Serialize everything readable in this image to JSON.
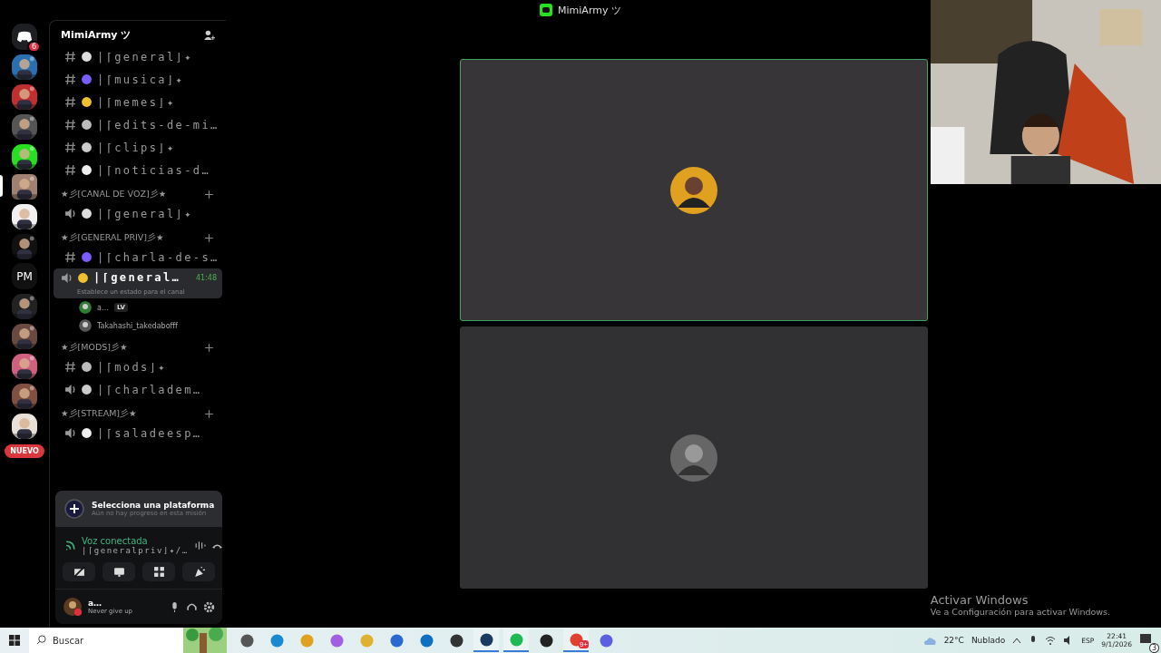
{
  "window": {
    "title": "MimiArmy ツ"
  },
  "servers": [
    {
      "kind": "home",
      "badge": "6",
      "selected": false
    },
    {
      "kind": "picture",
      "selected": false
    },
    {
      "kind": "picture",
      "selected": false
    },
    {
      "kind": "picture",
      "selected": false
    },
    {
      "kind": "picture",
      "selected": false
    },
    {
      "kind": "picture",
      "selected": true
    },
    {
      "kind": "picture",
      "selected": false
    },
    {
      "kind": "picture",
      "selected": false
    },
    {
      "kind": "text",
      "label": "PM",
      "selected": false
    },
    {
      "kind": "picture",
      "selected": false
    },
    {
      "kind": "picture",
      "selected": false
    },
    {
      "kind": "picture",
      "selected": false
    },
    {
      "kind": "picture",
      "selected": false
    },
    {
      "kind": "picture",
      "selected": false
    }
  ],
  "new_badge": "NUEVO",
  "sidebar": {
    "server_name": "MimiArmy ツ",
    "categories": [
      {
        "channels": [
          {
            "kind": "text",
            "name": "|⌈general⌋✦"
          },
          {
            "kind": "text",
            "name": "|⌈musica⌋✦"
          },
          {
            "kind": "text",
            "name": "|⌈memes⌋✦"
          },
          {
            "kind": "text",
            "name": "|⌈edits-de-mi…"
          },
          {
            "kind": "text",
            "name": "|⌈clips⌋✦"
          },
          {
            "kind": "text",
            "name": "|⌈noticias-d…"
          }
        ]
      },
      {
        "name": "★彡[CANAL DE VOZ]彡★",
        "channels": [
          {
            "kind": "voice",
            "name": "|⌈general⌋✦"
          }
        ]
      },
      {
        "name": "★彡[GENERAL PRIV]彡★",
        "channels": [
          {
            "kind": "text",
            "name": "|⌈charla-de-s…"
          },
          {
            "kind": "voice",
            "name": "|⌈general…",
            "selected": true,
            "time": "41:48",
            "status": "Establece un estado para el canal",
            "members": [
              {
                "name": "a…",
                "tag": "LV"
              },
              {
                "name": "Takahashi_takedabofff"
              }
            ]
          }
        ]
      },
      {
        "name": "★彡[MODS]彡★",
        "channels": [
          {
            "kind": "text",
            "name": "|⌈mods⌋✦"
          },
          {
            "kind": "voice",
            "name": "|⌈charladem…"
          }
        ]
      },
      {
        "name": "★彡[STREAM]彡★",
        "channels": [
          {
            "kind": "voice",
            "name": "|⌈saladeesp…"
          }
        ]
      }
    ]
  },
  "quest": {
    "title": "Selecciona una plataforma",
    "subtitle": "Aún no hay progreso en esta misión"
  },
  "voice": {
    "status": "Voz conectada",
    "channel": "|⌈generalpriv⌋✦/…"
  },
  "user": {
    "name": "a…",
    "status": "Never give up"
  },
  "tiles": [
    {
      "speaking": true
    },
    {
      "speaking": false
    }
  ],
  "activation": {
    "title": "Activar Windows",
    "text": "Ve a Configuración para activar Windows."
  },
  "taskbar": {
    "search": {
      "placeholder": "Buscar"
    },
    "apps": [
      {
        "running": false
      },
      {
        "running": false
      },
      {
        "running": false
      },
      {
        "running": false
      },
      {
        "running": false
      },
      {
        "running": false
      },
      {
        "running": false
      },
      {
        "running": false
      },
      {
        "running": true
      },
      {
        "running": true
      },
      {
        "running": false
      },
      {
        "running": true,
        "badge": "9+"
      },
      {
        "running": false
      }
    ],
    "weather": {
      "temp": "22°C",
      "condition": "Nublado"
    },
    "language": "ESP",
    "time": "22:41",
    "date": "9/1/2026",
    "notifications": "3"
  }
}
